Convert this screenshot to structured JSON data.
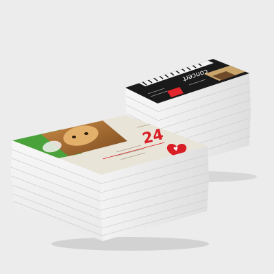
{
  "scene": {
    "background_color": "#ececec",
    "paper_color": "#ffffff",
    "edge_line_color": "#c9c9c9",
    "shadow_color": "#bdbdbd"
  },
  "back_stack": {
    "flyer": {
      "theme": "dark piano music concert flyer",
      "heading_text": "ʇɹǝɔuoɔ",
      "date_text": "ɯɐ",
      "panel_color": "#1a1a1a",
      "accent_color": "#e2242b"
    }
  },
  "front_stack": {
    "flyer": {
      "theme": "pet care flyer with cat photo and red heart",
      "big_number": "24",
      "heart_text": "♥",
      "panel_color": "#e9e4d8",
      "green_band_color": "#4aa23a",
      "accent_color": "#d81f26"
    }
  }
}
